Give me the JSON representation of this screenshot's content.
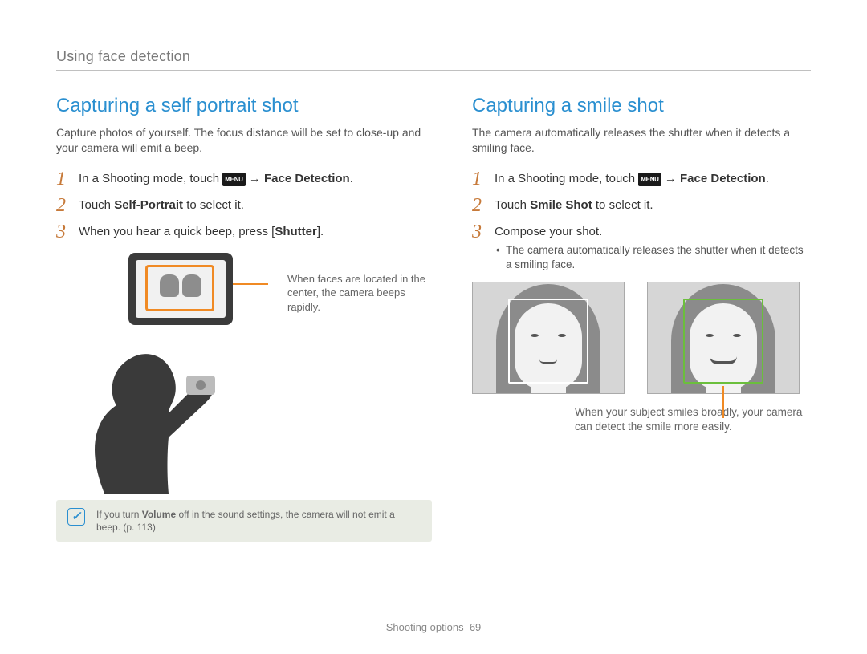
{
  "breadcrumb": "Using face detection",
  "menu_label": "MENU",
  "left": {
    "title": "Capturing a self portrait shot",
    "intro": "Capture photos of yourself. The focus distance will be set to close-up and your camera will emit a beep.",
    "step1": {
      "prefix": "In a Shooting mode, touch ",
      "arrow": " → ",
      "bold": "Face Detection",
      "tail": "."
    },
    "step2": {
      "prefix": "Touch ",
      "bold": "Self-Portrait",
      "tail": " to select it."
    },
    "step3": {
      "prefix": "When you hear a quick beep, press [",
      "bold": "Shutter",
      "tail": "]."
    },
    "callout": "When faces are located in the center, the camera beeps rapidly.",
    "note": {
      "prefix": "If you turn ",
      "bold": "Volume",
      "tail": " off in the sound settings, the camera will not emit a beep. (p. 113)"
    }
  },
  "right": {
    "title": "Capturing a smile shot",
    "intro": "The camera automatically releases the shutter when it detects a smiling face.",
    "step1": {
      "prefix": "In a Shooting mode, touch ",
      "arrow": " → ",
      "bold": "Face Detection",
      "tail": "."
    },
    "step2": {
      "prefix": "Touch ",
      "bold": "Smile Shot",
      "tail": " to select it."
    },
    "step3": "Compose your shot.",
    "bullet": "The camera automatically releases the shutter when it detects a smiling face.",
    "callout": "When your subject smiles broadly, your camera can detect the smile more easily."
  },
  "footer": {
    "label": "Shooting options",
    "page": "69"
  }
}
